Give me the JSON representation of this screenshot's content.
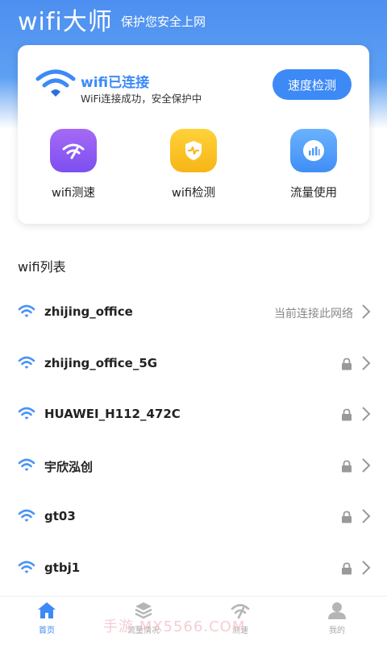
{
  "header": {
    "title": "wifi大师",
    "subtitle": "保护您安全上网"
  },
  "connection": {
    "title": "wifi已连接",
    "description": "WiFi连接成功，安全保护中",
    "speed_button": "速度检测"
  },
  "tools": [
    {
      "label": "wifi测速",
      "icon": "speed-icon"
    },
    {
      "label": "wifi检测",
      "icon": "shield-icon"
    },
    {
      "label": "流量使用",
      "icon": "traffic-icon"
    }
  ],
  "wifi_section": {
    "title": "wifi列表"
  },
  "wifi_list": [
    {
      "name": "zhijing_office",
      "status": "当前连接此网络",
      "locked": false
    },
    {
      "name": "zhijing_office_5G",
      "status": "",
      "locked": true
    },
    {
      "name": "HUAWEI_H112_472C",
      "status": "",
      "locked": true
    },
    {
      "name": "宇欣泓创",
      "status": "",
      "locked": true
    },
    {
      "name": "gt03",
      "status": "",
      "locked": true
    },
    {
      "name": "gtbj1",
      "status": "",
      "locked": true
    }
  ],
  "tabbar": [
    {
      "label": "首页",
      "icon": "home-icon",
      "active": true
    },
    {
      "label": "流量情况",
      "icon": "layers-icon",
      "active": false
    },
    {
      "label": "测速",
      "icon": "speed-icon",
      "active": false
    },
    {
      "label": "我的",
      "icon": "profile-icon",
      "active": false
    }
  ],
  "watermark": "手游·MX5566.COM",
  "colors": {
    "accent": "#3d8af7",
    "header_gradient_top": "#4d8ff0",
    "tool_purple": "#8c5cf2",
    "tool_yellow": "#f9c12a",
    "tool_blue": "#4f9cf8"
  }
}
